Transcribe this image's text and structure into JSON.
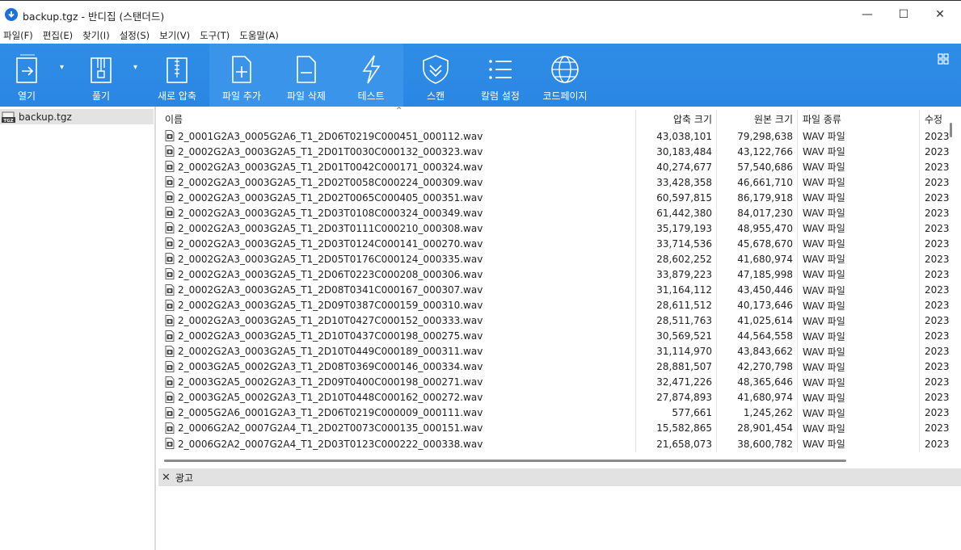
{
  "window": {
    "title": "backup.tgz - 반디집 (스탠더드)",
    "minimize_glyph": "—",
    "maximize_glyph": "☐",
    "close_glyph": "✕"
  },
  "menu": [
    {
      "label": "파일(F)"
    },
    {
      "label": "편집(E)"
    },
    {
      "label": "찾기(I)"
    },
    {
      "label": "설정(S)"
    },
    {
      "label": "보기(V)"
    },
    {
      "label": "도구(T)"
    },
    {
      "label": "도움말(A)"
    }
  ],
  "toolbar": {
    "accent": "#2a86e3",
    "buttons": [
      {
        "label": "열기",
        "icon": "open-icon"
      },
      {
        "label": "풀기",
        "icon": "extract-icon"
      },
      {
        "label": "새로 압축",
        "icon": "new-archive-icon"
      },
      {
        "label": "파일 추가",
        "icon": "add-file-icon"
      },
      {
        "label": "파일 삭제",
        "icon": "delete-file-icon"
      },
      {
        "label": "테스트",
        "icon": "test-icon"
      },
      {
        "label": "스캔",
        "icon": "scan-icon"
      },
      {
        "label": "칼럼 설정",
        "icon": "column-settings-icon"
      },
      {
        "label": "코드페이지",
        "icon": "codepage-icon"
      }
    ]
  },
  "tree": {
    "items": [
      {
        "label": "backup.tgz",
        "icon_text": "TGZ"
      }
    ]
  },
  "filelist": {
    "columns": {
      "name": "이름",
      "compressed": "압축 크기",
      "original": "원본 크기",
      "type": "파일 종류",
      "modified": "수정"
    },
    "rows": [
      {
        "name": "2_0001G2A3_0005G2A6_T1_2D06T0219C000451_000112.wav",
        "compressed": "43,038,101",
        "original": "79,298,638",
        "type": "WAV 파일",
        "modified": "2023"
      },
      {
        "name": "2_0002G2A3_0003G2A5_T1_2D01T0030C000132_000323.wav",
        "compressed": "30,183,484",
        "original": "43,122,766",
        "type": "WAV 파일",
        "modified": "2023"
      },
      {
        "name": "2_0002G2A3_0003G2A5_T1_2D01T0042C000171_000324.wav",
        "compressed": "40,274,677",
        "original": "57,540,686",
        "type": "WAV 파일",
        "modified": "2023"
      },
      {
        "name": "2_0002G2A3_0003G2A5_T1_2D02T0058C000224_000309.wav",
        "compressed": "33,428,358",
        "original": "46,661,710",
        "type": "WAV 파일",
        "modified": "2023"
      },
      {
        "name": "2_0002G2A3_0003G2A5_T1_2D02T0065C000405_000351.wav",
        "compressed": "60,597,815",
        "original": "86,179,918",
        "type": "WAV 파일",
        "modified": "2023"
      },
      {
        "name": "2_0002G2A3_0003G2A5_T1_2D03T0108C000324_000349.wav",
        "compressed": "61,442,380",
        "original": "84,017,230",
        "type": "WAV 파일",
        "modified": "2023"
      },
      {
        "name": "2_0002G2A3_0003G2A5_T1_2D03T0111C000210_000308.wav",
        "compressed": "35,179,193",
        "original": "48,955,470",
        "type": "WAV 파일",
        "modified": "2023"
      },
      {
        "name": "2_0002G2A3_0003G2A5_T1_2D03T0124C000141_000270.wav",
        "compressed": "33,714,536",
        "original": "45,678,670",
        "type": "WAV 파일",
        "modified": "2023"
      },
      {
        "name": "2_0002G2A3_0003G2A5_T1_2D05T0176C000124_000335.wav",
        "compressed": "28,602,252",
        "original": "41,680,974",
        "type": "WAV 파일",
        "modified": "2023"
      },
      {
        "name": "2_0002G2A3_0003G2A5_T1_2D06T0223C000208_000306.wav",
        "compressed": "33,879,223",
        "original": "47,185,998",
        "type": "WAV 파일",
        "modified": "2023"
      },
      {
        "name": "2_0002G2A3_0003G2A5_T1_2D08T0341C000167_000307.wav",
        "compressed": "31,164,112",
        "original": "43,450,446",
        "type": "WAV 파일",
        "modified": "2023"
      },
      {
        "name": "2_0002G2A3_0003G2A5_T1_2D09T0387C000159_000310.wav",
        "compressed": "28,611,512",
        "original": "40,173,646",
        "type": "WAV 파일",
        "modified": "2023"
      },
      {
        "name": "2_0002G2A3_0003G2A5_T1_2D10T0427C000152_000333.wav",
        "compressed": "28,511,763",
        "original": "41,025,614",
        "type": "WAV 파일",
        "modified": "2023"
      },
      {
        "name": "2_0002G2A3_0003G2A5_T1_2D10T0437C000198_000275.wav",
        "compressed": "30,569,521",
        "original": "44,564,558",
        "type": "WAV 파일",
        "modified": "2023"
      },
      {
        "name": "2_0002G2A3_0003G2A5_T1_2D10T0449C000189_000311.wav",
        "compressed": "31,114,970",
        "original": "43,843,662",
        "type": "WAV 파일",
        "modified": "2023"
      },
      {
        "name": "2_0003G2A5_0002G2A3_T1_2D08T0369C000146_000334.wav",
        "compressed": "28,881,507",
        "original": "42,270,798",
        "type": "WAV 파일",
        "modified": "2023"
      },
      {
        "name": "2_0003G2A5_0002G2A3_T1_2D09T0400C000198_000271.wav",
        "compressed": "32,471,226",
        "original": "48,365,646",
        "type": "WAV 파일",
        "modified": "2023"
      },
      {
        "name": "2_0003G2A5_0002G2A3_T1_2D10T0448C000162_000272.wav",
        "compressed": "27,874,893",
        "original": "41,680,974",
        "type": "WAV 파일",
        "modified": "2023"
      },
      {
        "name": "2_0005G2A6_0001G2A3_T1_2D06T0219C000009_000111.wav",
        "compressed": "577,661",
        "original": "1,245,262",
        "type": "WAV 파일",
        "modified": "2023"
      },
      {
        "name": "2_0006G2A2_0007G2A4_T1_2D02T0073C000135_000151.wav",
        "compressed": "15,582,865",
        "original": "28,901,454",
        "type": "WAV 파일",
        "modified": "2023"
      },
      {
        "name": "2_0006G2A2_0007G2A4_T1_2D03T0123C000222_000338.wav",
        "compressed": "21,658,073",
        "original": "38,600,782",
        "type": "WAV 파일",
        "modified": "2023"
      }
    ]
  },
  "ad_panel": {
    "close_glyph": "✕",
    "label": "광고"
  }
}
